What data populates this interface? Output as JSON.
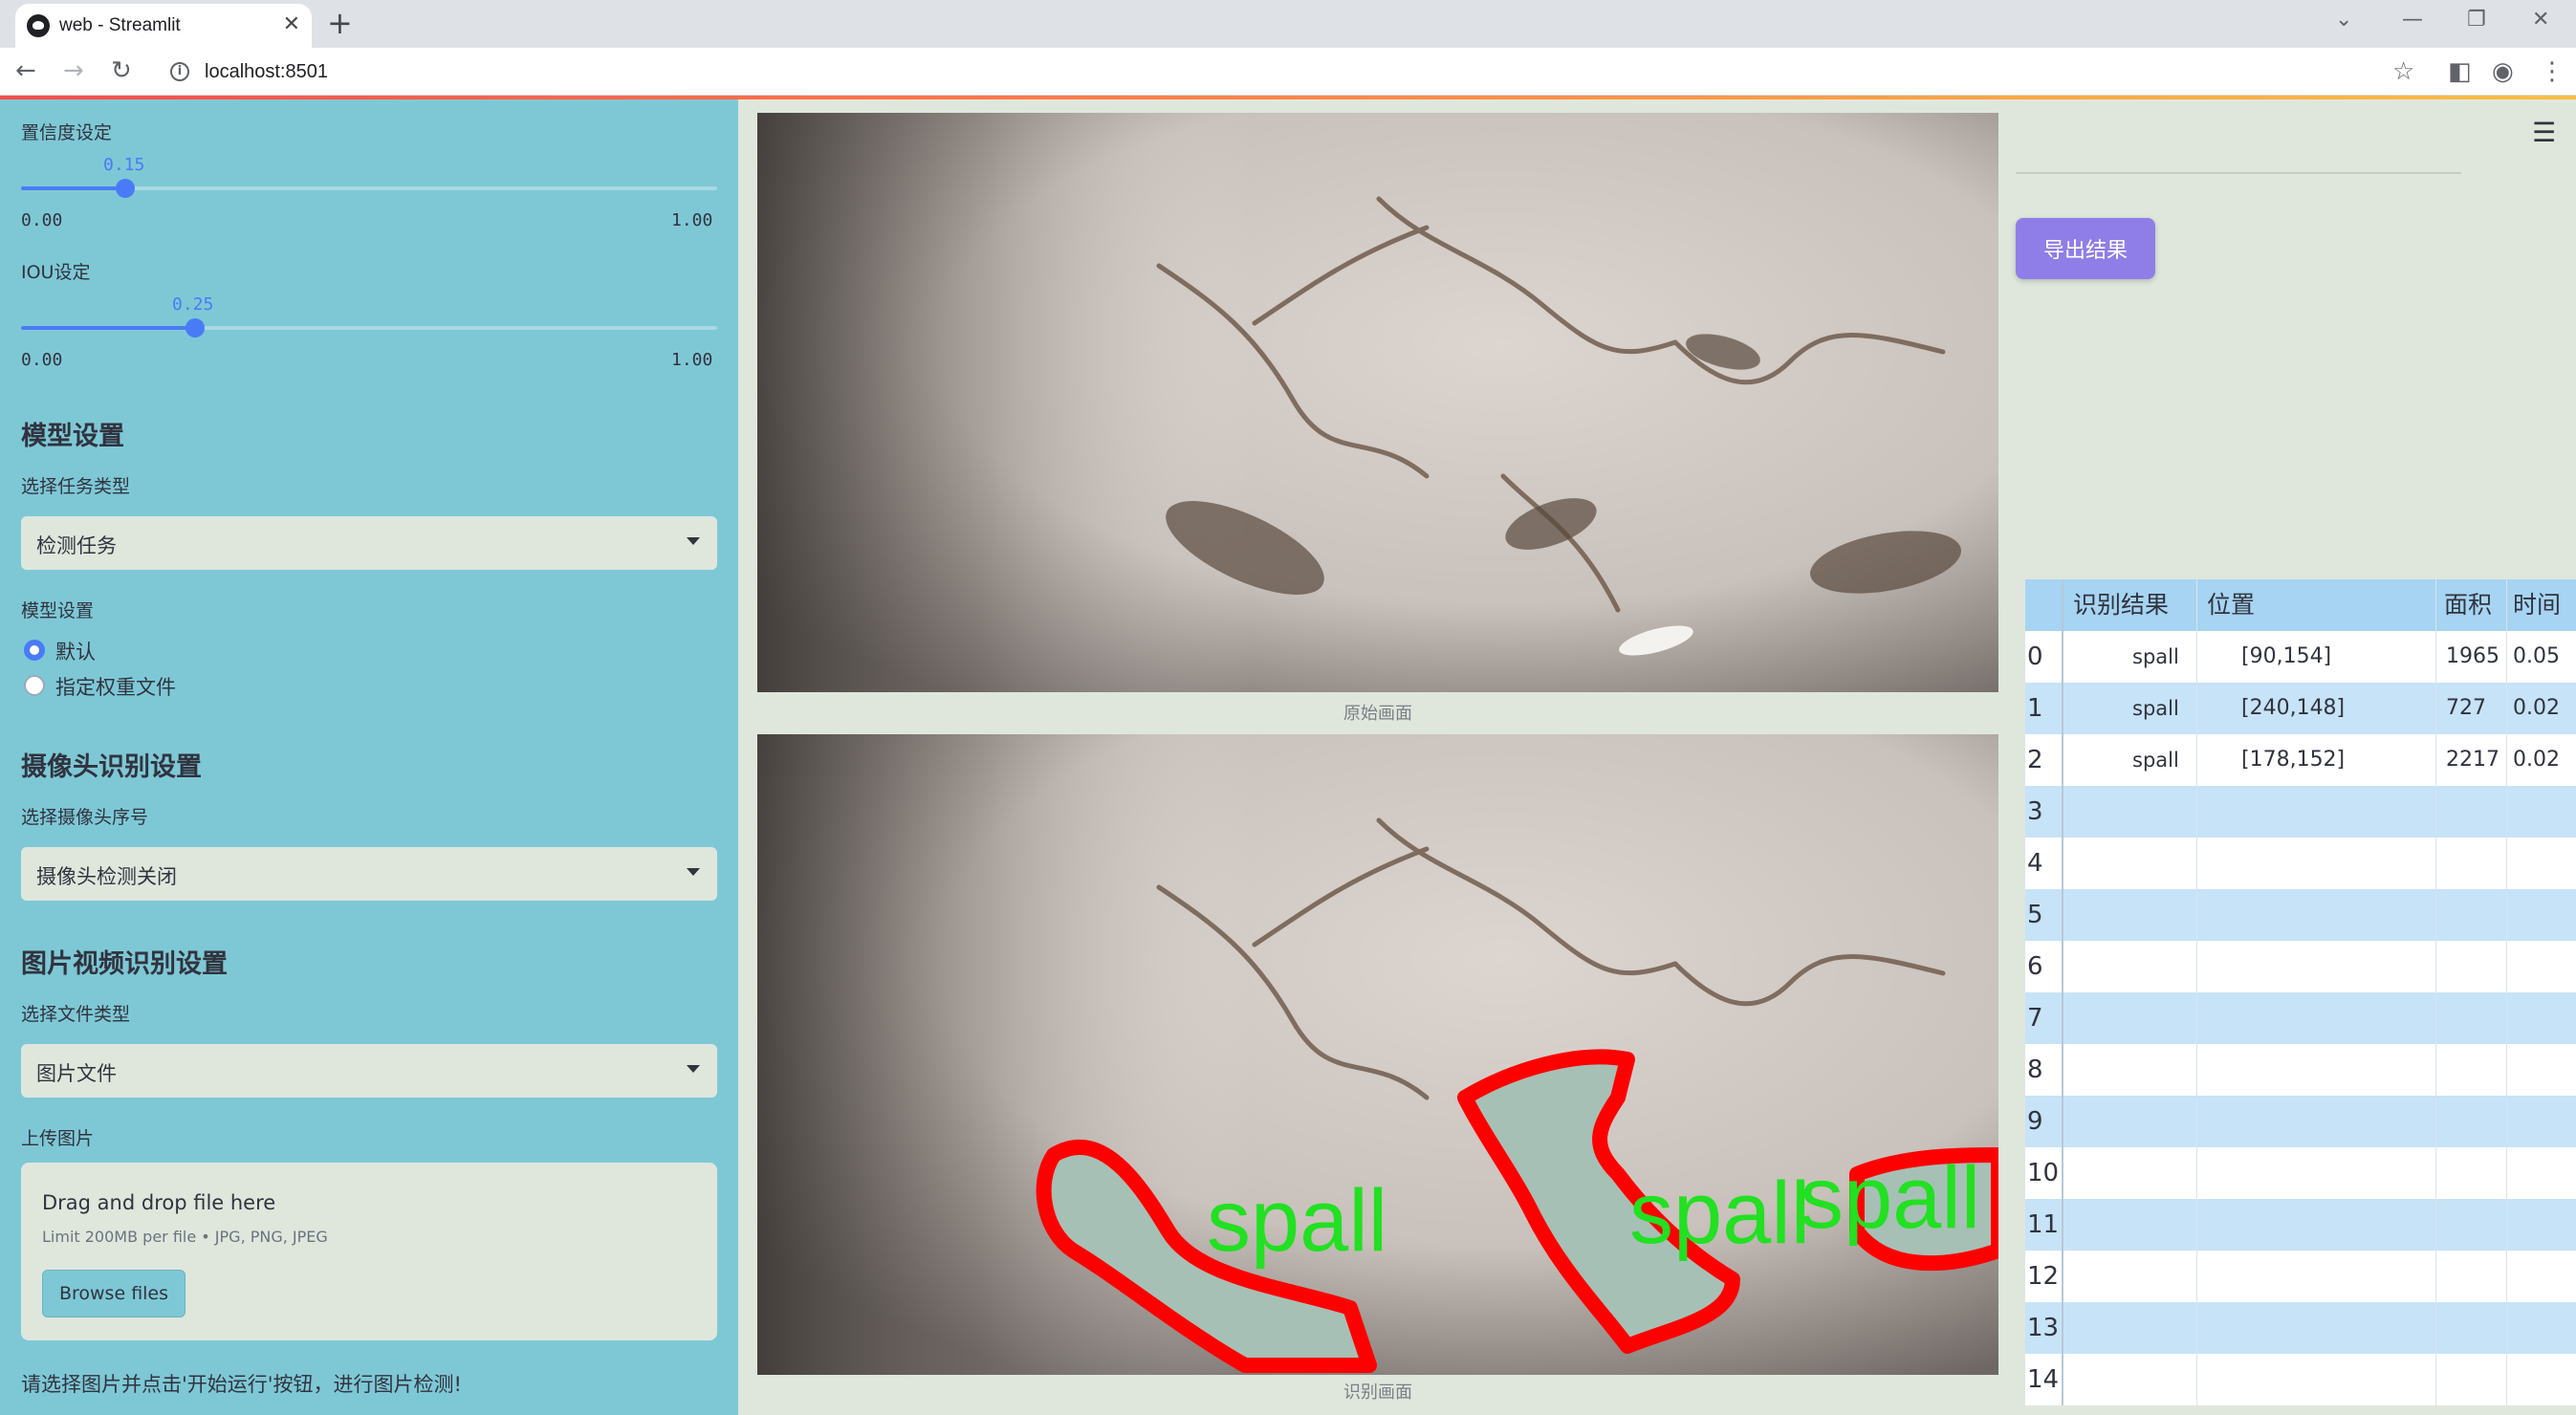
{
  "browser": {
    "tab_title": "web - Streamlit",
    "url": "localhost:8501"
  },
  "sidebar": {
    "confidence": {
      "label": "置信度设定",
      "value_text": "0.15",
      "value": 0.15,
      "min": "0.00",
      "max": "1.00"
    },
    "iou": {
      "label": "IOU设定",
      "value_text": "0.25",
      "value": 0.25,
      "min": "0.00",
      "max": "1.00"
    },
    "model_section": {
      "heading": "模型设置",
      "task_label": "选择任务类型",
      "task_value": "检测任务",
      "model_label": "模型设置",
      "radio_options": [
        "默认",
        "指定权重文件"
      ],
      "radio_selected": "默认"
    },
    "camera_section": {
      "heading": "摄像头识别设置",
      "camera_label": "选择摄像头序号",
      "camera_value": "摄像头检测关闭"
    },
    "media_section": {
      "heading": "图片视频识别设置",
      "file_type_label": "选择文件类型",
      "file_type_value": "图片文件",
      "upload_label": "上传图片",
      "drop_title": "Drag and drop file here",
      "drop_limit": "Limit 200MB per file • JPG, PNG, JPEG",
      "browse_label": "Browse files"
    },
    "hint": "请选择图片并点击'开始运行'按钮，进行图片检测!"
  },
  "main": {
    "original_caption": "原始画面",
    "detected_caption": "识别画面",
    "detection_labels": [
      "spall",
      "spall",
      "spall"
    ]
  },
  "right": {
    "export_label": "导出结果",
    "table": {
      "columns": [
        "",
        "识别结果",
        "位置",
        "面积",
        "时间"
      ],
      "rows": [
        {
          "idx": "0",
          "result": "spall",
          "position": "[90,154]",
          "area": "1965",
          "time": "0.05"
        },
        {
          "idx": "1",
          "result": "spall",
          "position": "[240,148]",
          "area": "727",
          "time": "0.02"
        },
        {
          "idx": "2",
          "result": "spall",
          "position": "[178,152]",
          "area": "2217",
          "time": "0.02"
        },
        {
          "idx": "3",
          "result": "",
          "position": "",
          "area": "",
          "time": ""
        },
        {
          "idx": "4",
          "result": "",
          "position": "",
          "area": "",
          "time": ""
        },
        {
          "idx": "5",
          "result": "",
          "position": "",
          "area": "",
          "time": ""
        },
        {
          "idx": "6",
          "result": "",
          "position": "",
          "area": "",
          "time": ""
        },
        {
          "idx": "7",
          "result": "",
          "position": "",
          "area": "",
          "time": ""
        },
        {
          "idx": "8",
          "result": "",
          "position": "",
          "area": "",
          "time": ""
        },
        {
          "idx": "9",
          "result": "",
          "position": "",
          "area": "",
          "time": ""
        },
        {
          "idx": "10",
          "result": "",
          "position": "",
          "area": "",
          "time": ""
        },
        {
          "idx": "11",
          "result": "",
          "position": "",
          "area": "",
          "time": ""
        },
        {
          "idx": "12",
          "result": "",
          "position": "",
          "area": "",
          "time": ""
        },
        {
          "idx": "13",
          "result": "",
          "position": "",
          "area": "",
          "time": ""
        },
        {
          "idx": "14",
          "result": "",
          "position": "",
          "area": "",
          "time": ""
        }
      ]
    }
  },
  "colors": {
    "sidebar_bg": "#7ec8d6",
    "main_bg": "#dfe7dc",
    "accent": "#4a7bf7",
    "export_button": "#8f7ee8",
    "detection_outline": "#ff0000",
    "detection_text": "#22e022"
  }
}
